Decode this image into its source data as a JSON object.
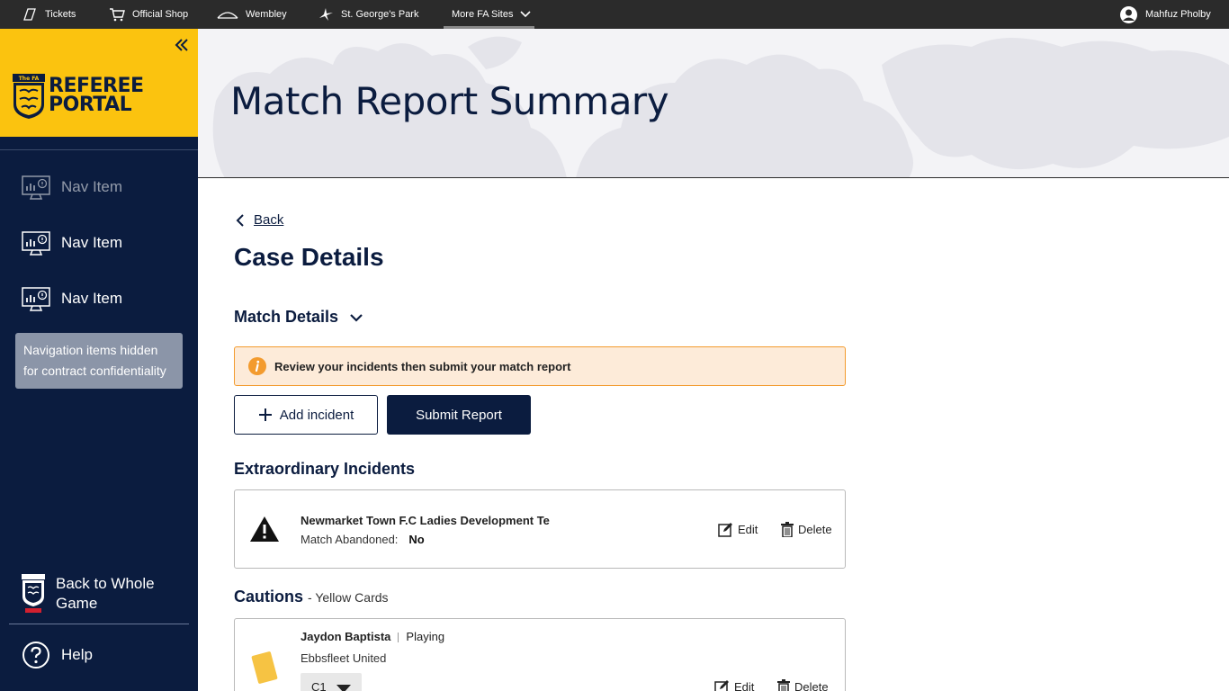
{
  "topbar": {
    "links": [
      "Tickets",
      "Official Shop",
      "Wembley",
      "St. George's Park",
      "More FA Sites"
    ],
    "user": "Mahfuz Pholby"
  },
  "sidebar": {
    "brand_line1": "REFEREE",
    "brand_line2": "PORTAL",
    "crest_text": "The FA",
    "nav_items": [
      {
        "label": "Nav Item",
        "state": "dim"
      },
      {
        "label": "Nav Item",
        "state": "normal"
      },
      {
        "label": "Nav Item",
        "state": "normal"
      }
    ],
    "hidden_note": "Navigation items hidden for contract confidentiality",
    "back_label": "Back to Whole Game",
    "help_label": "Help"
  },
  "hero": {
    "title": "Match Report Summary"
  },
  "main": {
    "back_label": "Back",
    "case_title": "Case Details",
    "match_details_label": "Match Details",
    "banner_text": "Review your incidents then submit your match report",
    "add_incident_label": "Add incident",
    "submit_label": "Submit Report",
    "extraordinary": {
      "title": "Extraordinary Incidents",
      "name": "Newmarket Town F.C Ladies Development Te",
      "field_label": "Match Abandoned:",
      "field_value": "No",
      "edit_label": "Edit",
      "delete_label": "Delete"
    },
    "cautions": {
      "title": "Cautions",
      "subtitle": "- Yellow Cards",
      "player": "Jaydon Baptista",
      "status": "Playing",
      "club": "Ebbsfleet United",
      "code": "C1",
      "edit_label": "Edit",
      "delete_label": "Delete"
    }
  },
  "colors": {
    "navy": "#0b1c3f",
    "yellow": "#fbc30f",
    "topbar": "#2b2b2b",
    "banner_bg": "#fdebd9",
    "banner_border": "#f39b2e",
    "card_yellow": "#f6c343"
  }
}
